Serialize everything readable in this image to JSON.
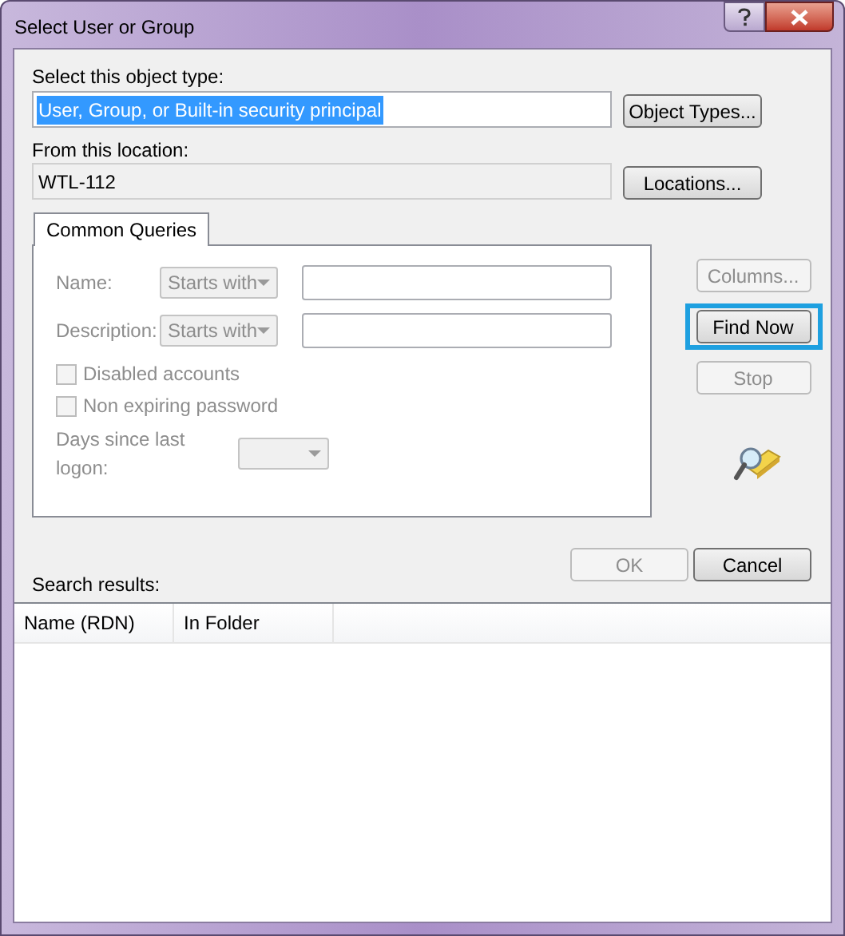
{
  "window": {
    "title": "Select User or Group"
  },
  "title_buttons": [
    {
      "kind": "help"
    },
    {
      "kind": "close"
    }
  ],
  "object_type": {
    "label": "Select this object type:",
    "value": "User, Group, or Built-in security principal",
    "selected": true,
    "button": "Object Types..."
  },
  "location": {
    "label": "From this location:",
    "value": "WTL-112",
    "button": "Locations..."
  },
  "tabs": [
    {
      "label": "Common Queries",
      "selected": true
    }
  ],
  "queries": {
    "disabled": true,
    "rows": [
      {
        "label": "Name:",
        "operator": "Starts with"
      },
      {
        "label": "Description:",
        "operator": "Starts with"
      }
    ],
    "checkboxes": [
      {
        "label": "Disabled accounts",
        "checked": false
      },
      {
        "label": "Non expiring password",
        "checked": false
      }
    ],
    "days": {
      "label": "Days since last logon:"
    }
  },
  "side_buttons": [
    {
      "label": "Columns...",
      "disabled": true,
      "highlighted": false
    },
    {
      "label": "Find Now",
      "disabled": false,
      "highlighted": true
    },
    {
      "label": "Stop",
      "disabled": true,
      "highlighted": false
    }
  ],
  "dialog_buttons": [
    {
      "label": "OK",
      "disabled": true
    },
    {
      "label": "Cancel",
      "disabled": false
    }
  ],
  "results": {
    "label": "Search results:",
    "columns": [
      "Name (RDN)",
      "In Folder"
    ]
  }
}
